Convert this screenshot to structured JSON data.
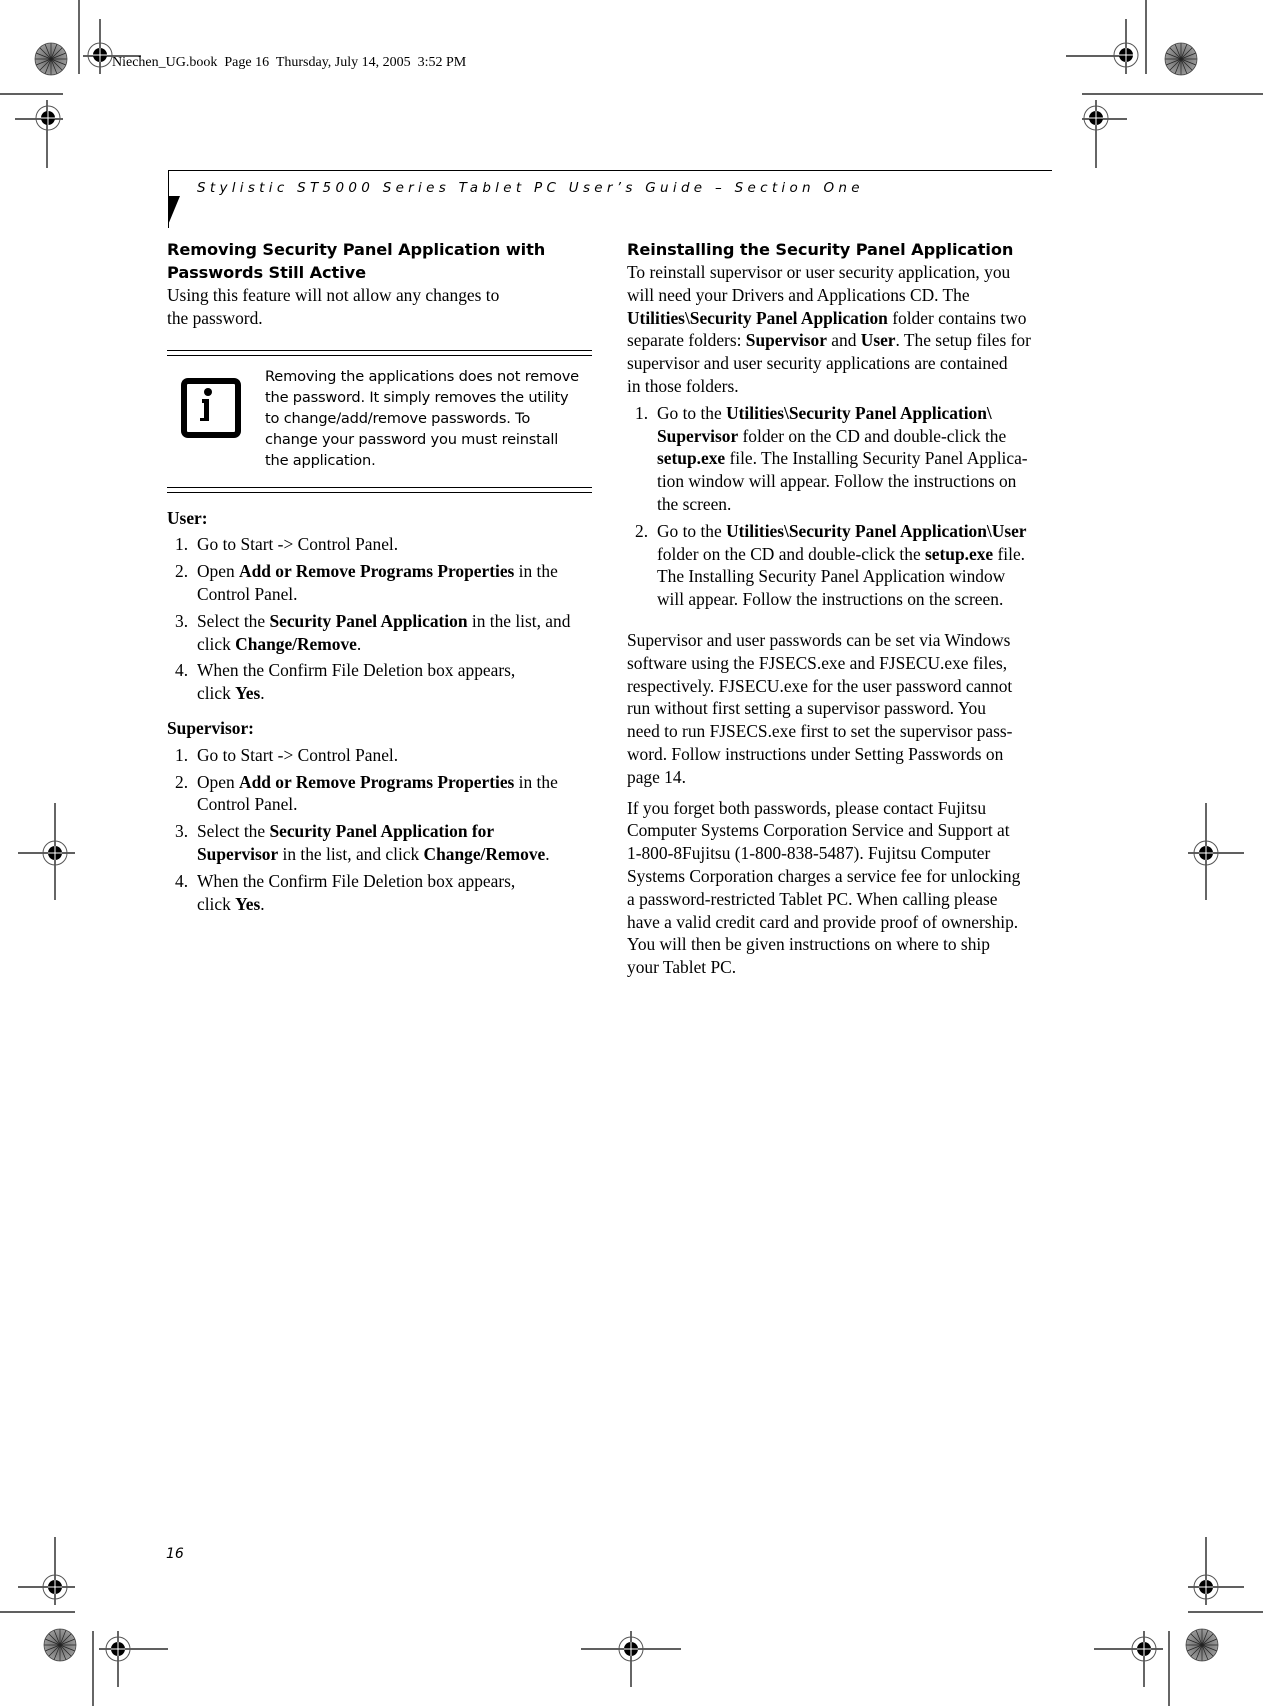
{
  "slug": {
    "text": "Niechen_UG.book  Page 16  Thursday, July 14, 2005  3:52 PM"
  },
  "header": {
    "running_title": "Stylistic ST5000 Series Tablet PC User’s Guide – Section One"
  },
  "left_column": {
    "section_title_line1": "Removing Security Panel Application with",
    "section_title_line2": "Passwords Still Active",
    "intro_line1": "Using this feature will not allow any changes to",
    "intro_line2": "the password.",
    "note": {
      "icon": "info-icon",
      "lines": [
        "Removing the applications does not remove",
        "the password. It simply removes the utility",
        "to change/add/remove passwords. To",
        "change your password you must reinstall",
        "the application."
      ]
    },
    "user": {
      "heading": "User:",
      "steps": [
        {
          "num": "1.",
          "parts": [
            [
              "t",
              "Go to Start -> Control Panel."
            ]
          ]
        },
        {
          "num": "2.",
          "parts": [
            [
              "t",
              "Open "
            ],
            [
              "b",
              "Add or Remove Programs Properties"
            ],
            [
              "t",
              " in the"
            ],
            [
              "br",
              ""
            ],
            [
              "t",
              "Control Panel."
            ]
          ]
        },
        {
          "num": "3.",
          "parts": [
            [
              "t",
              "Select the "
            ],
            [
              "b",
              "Security Panel Application"
            ],
            [
              "t",
              " in the list, and"
            ],
            [
              "br",
              ""
            ],
            [
              "t",
              "click "
            ],
            [
              "b",
              "Change/Remove"
            ],
            [
              "t",
              "."
            ]
          ]
        },
        {
          "num": "4.",
          "parts": [
            [
              "t",
              "When the Confirm File Deletion box appears,"
            ],
            [
              "br",
              ""
            ],
            [
              "t",
              "click "
            ],
            [
              "b",
              "Yes"
            ],
            [
              "t",
              "."
            ]
          ]
        }
      ]
    },
    "supervisor": {
      "heading": "Supervisor:",
      "steps": [
        {
          "num": "1.",
          "parts": [
            [
              "t",
              "Go to Start -> Control Panel."
            ]
          ]
        },
        {
          "num": "2.",
          "parts": [
            [
              "t",
              "Open "
            ],
            [
              "b",
              "Add or Remove Programs Properties"
            ],
            [
              "t",
              " in the"
            ],
            [
              "br",
              ""
            ],
            [
              "t",
              "Control Panel."
            ]
          ]
        },
        {
          "num": "3.",
          "parts": [
            [
              "t",
              "Select the "
            ],
            [
              "b",
              "Security Panel Application for"
            ],
            [
              "br",
              ""
            ],
            [
              "b",
              "Supervisor"
            ],
            [
              "t",
              " in the list, and click "
            ],
            [
              "b",
              "Change/Remove"
            ],
            [
              "t",
              "."
            ]
          ]
        },
        {
          "num": "4.",
          "parts": [
            [
              "t",
              "When the Confirm File Deletion box appears,"
            ],
            [
              "br",
              ""
            ],
            [
              "t",
              "click "
            ],
            [
              "b",
              "Yes"
            ],
            [
              "t",
              "."
            ]
          ]
        }
      ]
    }
  },
  "right_column": {
    "section_title": "Reinstalling the Security Panel Application",
    "intro": [
      [
        "t",
        "To reinstall supervisor or user security application, you"
      ],
      [
        "br",
        ""
      ],
      [
        "t",
        "will need your Drivers and Applications CD. The"
      ],
      [
        "br",
        ""
      ],
      [
        "b",
        "Utilities\\Security Panel Application"
      ],
      [
        "t",
        " folder contains two"
      ],
      [
        "br",
        ""
      ],
      [
        "t",
        "separate folders: "
      ],
      [
        "b",
        "Supervisor"
      ],
      [
        "t",
        " and "
      ],
      [
        "b",
        "User"
      ],
      [
        "t",
        ". The setup files for"
      ],
      [
        "br",
        ""
      ],
      [
        "t",
        "supervisor and user security applications are contained"
      ],
      [
        "br",
        ""
      ],
      [
        "t",
        "in those folders."
      ]
    ],
    "steps": [
      {
        "num": "1.",
        "parts": [
          [
            "t",
            "Go to the "
          ],
          [
            "b",
            "Utilities\\Security Panel Application\\"
          ],
          [
            "br",
            ""
          ],
          [
            "b",
            "Supervisor"
          ],
          [
            "t",
            " folder on the CD and double-click the"
          ],
          [
            "br",
            ""
          ],
          [
            "b",
            "setup.exe"
          ],
          [
            "t",
            " file. The Installing Security Panel Applica-"
          ],
          [
            "br",
            ""
          ],
          [
            "t",
            "tion window will appear. Follow the instructions on"
          ],
          [
            "br",
            ""
          ],
          [
            "t",
            "the screen."
          ]
        ]
      },
      {
        "num": "2.",
        "parts": [
          [
            "t",
            "Go to the "
          ],
          [
            "b",
            "Utilities\\Security Panel Application\\User"
          ],
          [
            "br",
            ""
          ],
          [
            "t",
            "folder on the CD and double-click the "
          ],
          [
            "b",
            "setup.exe"
          ],
          [
            "t",
            " file."
          ],
          [
            "br",
            ""
          ],
          [
            "t",
            "The Installing Security Panel Application window"
          ],
          [
            "br",
            ""
          ],
          [
            "t",
            "will appear. Follow the instructions on the screen."
          ]
        ]
      }
    ],
    "paragraph_passwords": [
      "Supervisor and user passwords can be set via Windows",
      "software using the FJSECS.exe and FJSECU.exe files,",
      "respectively. FJSECU.exe for the user password cannot",
      "run without first setting a supervisor password. You",
      "need to run FJSECS.exe first to set the supervisor pass-",
      "word. Follow instructions under Setting Passwords on",
      "page 14."
    ],
    "paragraph_forgot": [
      "If you forget both passwords, please contact Fujitsu",
      "Computer Systems Corporation Service and Support at",
      "1-800-8Fujitsu (1-800-838-5487). Fujitsu Computer",
      "Systems Corporation charges a service fee for unlocking",
      "a password-restricted Tablet PC. When calling please",
      "have a valid credit card and provide proof of ownership.",
      "You will then be given instructions on where to ship",
      "your Tablet PC."
    ]
  },
  "footer": {
    "page_number": "16"
  },
  "marks": {
    "registration": "registration-mark-icon",
    "color_bar": "starburst-color-target-icon"
  }
}
